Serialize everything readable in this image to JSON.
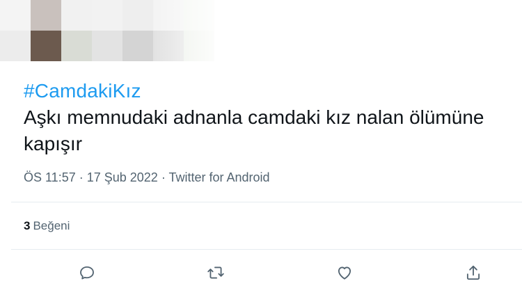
{
  "tweet": {
    "hashtag": "#CamdakiKız",
    "text": "Aşkı memnudaki adnanla camdaki kız nalan ölümüne kapışır",
    "time": "ÖS 11:57",
    "separator1": " · ",
    "date": "17 Şub 2022",
    "separator2": " · ",
    "source": "Twitter for Android",
    "likes_count": "3",
    "likes_label": "Beğeni"
  },
  "actions": [
    {
      "icon": "reply-icon"
    },
    {
      "icon": "retweet-icon"
    },
    {
      "icon": "like-icon"
    },
    {
      "icon": "share-icon"
    }
  ],
  "colors": {
    "accent": "#1d9bf0",
    "text": "#0f1419",
    "secondary": "#536471",
    "divider": "#e6ecf0"
  }
}
